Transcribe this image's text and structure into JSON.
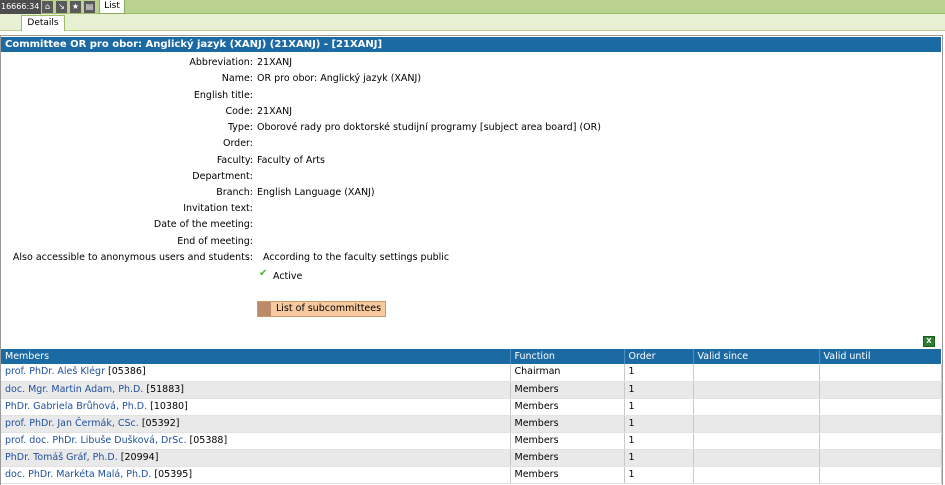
{
  "toolbar": {
    "session": "16666:34",
    "icons": [
      "home-icon",
      "arrow-icon",
      "star-icon",
      "print-icon"
    ],
    "tab_list": "List"
  },
  "subtabs": {
    "details": "Details"
  },
  "committee": {
    "title": "Committee OR pro obor: Anglický jazyk (XANJ) (21XANJ) - [21XANJ]",
    "properties": [
      {
        "label": "Abbreviation:",
        "value": "21XANJ"
      },
      {
        "label": "Name:",
        "value": "OR pro obor: Anglický jazyk (XANJ)"
      },
      {
        "label": "English title:",
        "value": ""
      },
      {
        "label": "Code:",
        "value": "21XANJ"
      },
      {
        "label": "Type:",
        "value": "Oborové rady pro doktorské studijní programy [subject area board] (OR)"
      },
      {
        "label": "Order:",
        "value": ""
      },
      {
        "label": "Faculty:",
        "value": "Faculty of Arts"
      },
      {
        "label": "Department:",
        "value": ""
      },
      {
        "label": "Branch:",
        "value": "English Language (XANJ)"
      },
      {
        "label": "Invitation text:",
        "value": ""
      },
      {
        "label": "Date of the meeting:",
        "value": ""
      },
      {
        "label": "End of meeting:",
        "value": ""
      },
      {
        "label": "Also accessible to anonymous users and students:",
        "value": "According to the faculty settings public"
      }
    ],
    "active_label": "Active",
    "subcommittees_button": "List of subcommittees"
  },
  "members_table": {
    "headers": [
      "Members",
      "Function",
      "Order",
      "Valid since",
      "Valid until"
    ],
    "rows": [
      {
        "name": "prof. PhDr. Aleš Klégr",
        "id": "[05386]",
        "function": "Chairman",
        "order": "1",
        "since": "",
        "until": ""
      },
      {
        "name": "doc. Mgr. Martin Adam, Ph.D.",
        "id": "[51883]",
        "function": "Members",
        "order": "1",
        "since": "",
        "until": ""
      },
      {
        "name": "PhDr. Gabriela Brůhová, Ph.D.",
        "id": "[10380]",
        "function": "Members",
        "order": "1",
        "since": "",
        "until": ""
      },
      {
        "name": "prof. PhDr. Jan Čermák, CSc.",
        "id": "[05392]",
        "function": "Members",
        "order": "1",
        "since": "",
        "until": ""
      },
      {
        "name": "prof. doc. PhDr. Libuše Dušková, DrSc.",
        "id": "[05388]",
        "function": "Members",
        "order": "1",
        "since": "",
        "until": ""
      },
      {
        "name": "PhDr. Tomáš Gráf, Ph.D.",
        "id": "[20994]",
        "function": "Members",
        "order": "1",
        "since": "",
        "until": ""
      },
      {
        "name": "doc. PhDr. Markéta Malá, Ph.D.",
        "id": "[05395]",
        "function": "Members",
        "order": "1",
        "since": "",
        "until": ""
      }
    ]
  }
}
